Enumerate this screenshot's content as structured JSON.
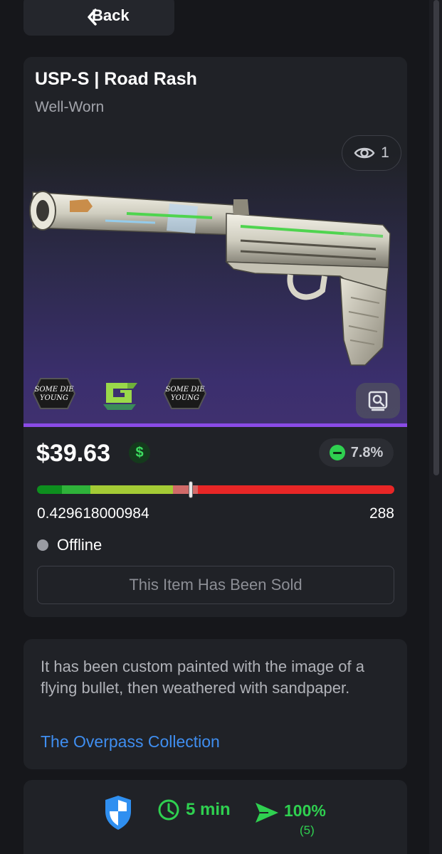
{
  "nav": {
    "back_label": "Back"
  },
  "item": {
    "name": "USP-S | Road Rash",
    "wear": "Well-Worn",
    "views": "1",
    "price": "$39.63",
    "price_change": "7.8%",
    "price_change_direction": "down",
    "float_value": "0.429618000984",
    "float_fraction": 0.4296,
    "paint_seed": "288",
    "status": "Offline",
    "sold_label": "This Item Has Been Sold",
    "stickers": [
      "Some Die Young",
      "OpTic Gaming",
      "Some Die Young"
    ],
    "description": "It has been custom painted with the image of a flying bullet, then weathered with sandpaper.",
    "collection": "The Overpass Collection"
  },
  "seller": {
    "delivery_time": "5 min",
    "success_rate": "100%",
    "trades_count": "(5)"
  },
  "colors": {
    "accent_green": "#2fd050",
    "link_blue": "#3f8ef0",
    "rarity_purple": "#8a4be6",
    "float_segments": [
      "#0d8f1e",
      "#2fb33a",
      "#a4cb35",
      "#d06a68",
      "#e82626"
    ]
  },
  "icons": {
    "back": "chevron-left-icon",
    "views": "eye-icon",
    "inspect": "inspect-icon",
    "cash": "dollar-icon",
    "trend": "minus-circle-icon",
    "shield": "shield-icon",
    "clock": "clock-icon",
    "send": "send-icon"
  }
}
